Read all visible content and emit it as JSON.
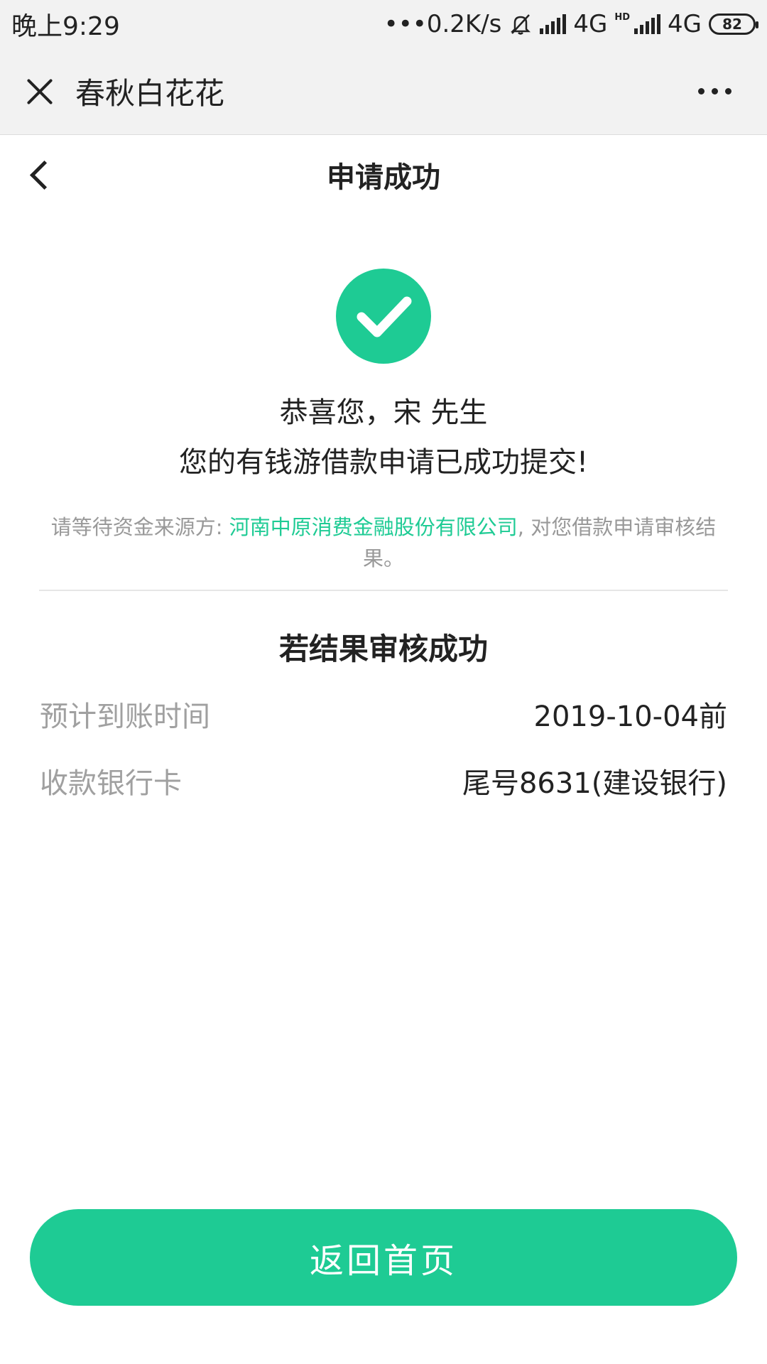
{
  "status_bar": {
    "time": "晚上9:29",
    "network_speed": "•••0.2K/s",
    "sim1_type": "4G",
    "sim2_hd": "HD",
    "sim2_type": "4G",
    "battery": "82",
    "icons": [
      "bell-muted-icon",
      "signal-icon",
      "signal-icon",
      "battery-icon"
    ]
  },
  "wechat_bar": {
    "title": "春秋白花花",
    "close_icon": "close-icon",
    "more_icon": "more-dots-icon"
  },
  "header": {
    "title": "申请成功",
    "back_icon": "chevron-left-icon"
  },
  "success": {
    "icon": "check-circle-icon",
    "greeting": "恭喜您，宋 先生",
    "message": "您的有钱游借款申请已成功提交!"
  },
  "notice": {
    "prefix": "请等待资金来源方: ",
    "company": "河南中原消费金融股份有限公司",
    "suffix": ", 对您借款申请审核结果。"
  },
  "result": {
    "title": "若结果审核成功",
    "rows": [
      {
        "label": "预计到账时间",
        "value": "2019-10-04前"
      },
      {
        "label": "收款银行卡",
        "value": "尾号8631(建设银行)"
      }
    ]
  },
  "actions": {
    "home_button": "返回首页"
  },
  "colors": {
    "accent": "#1ecb94",
    "bar_bg": "#f2f2f2",
    "muted_text": "#999999"
  }
}
